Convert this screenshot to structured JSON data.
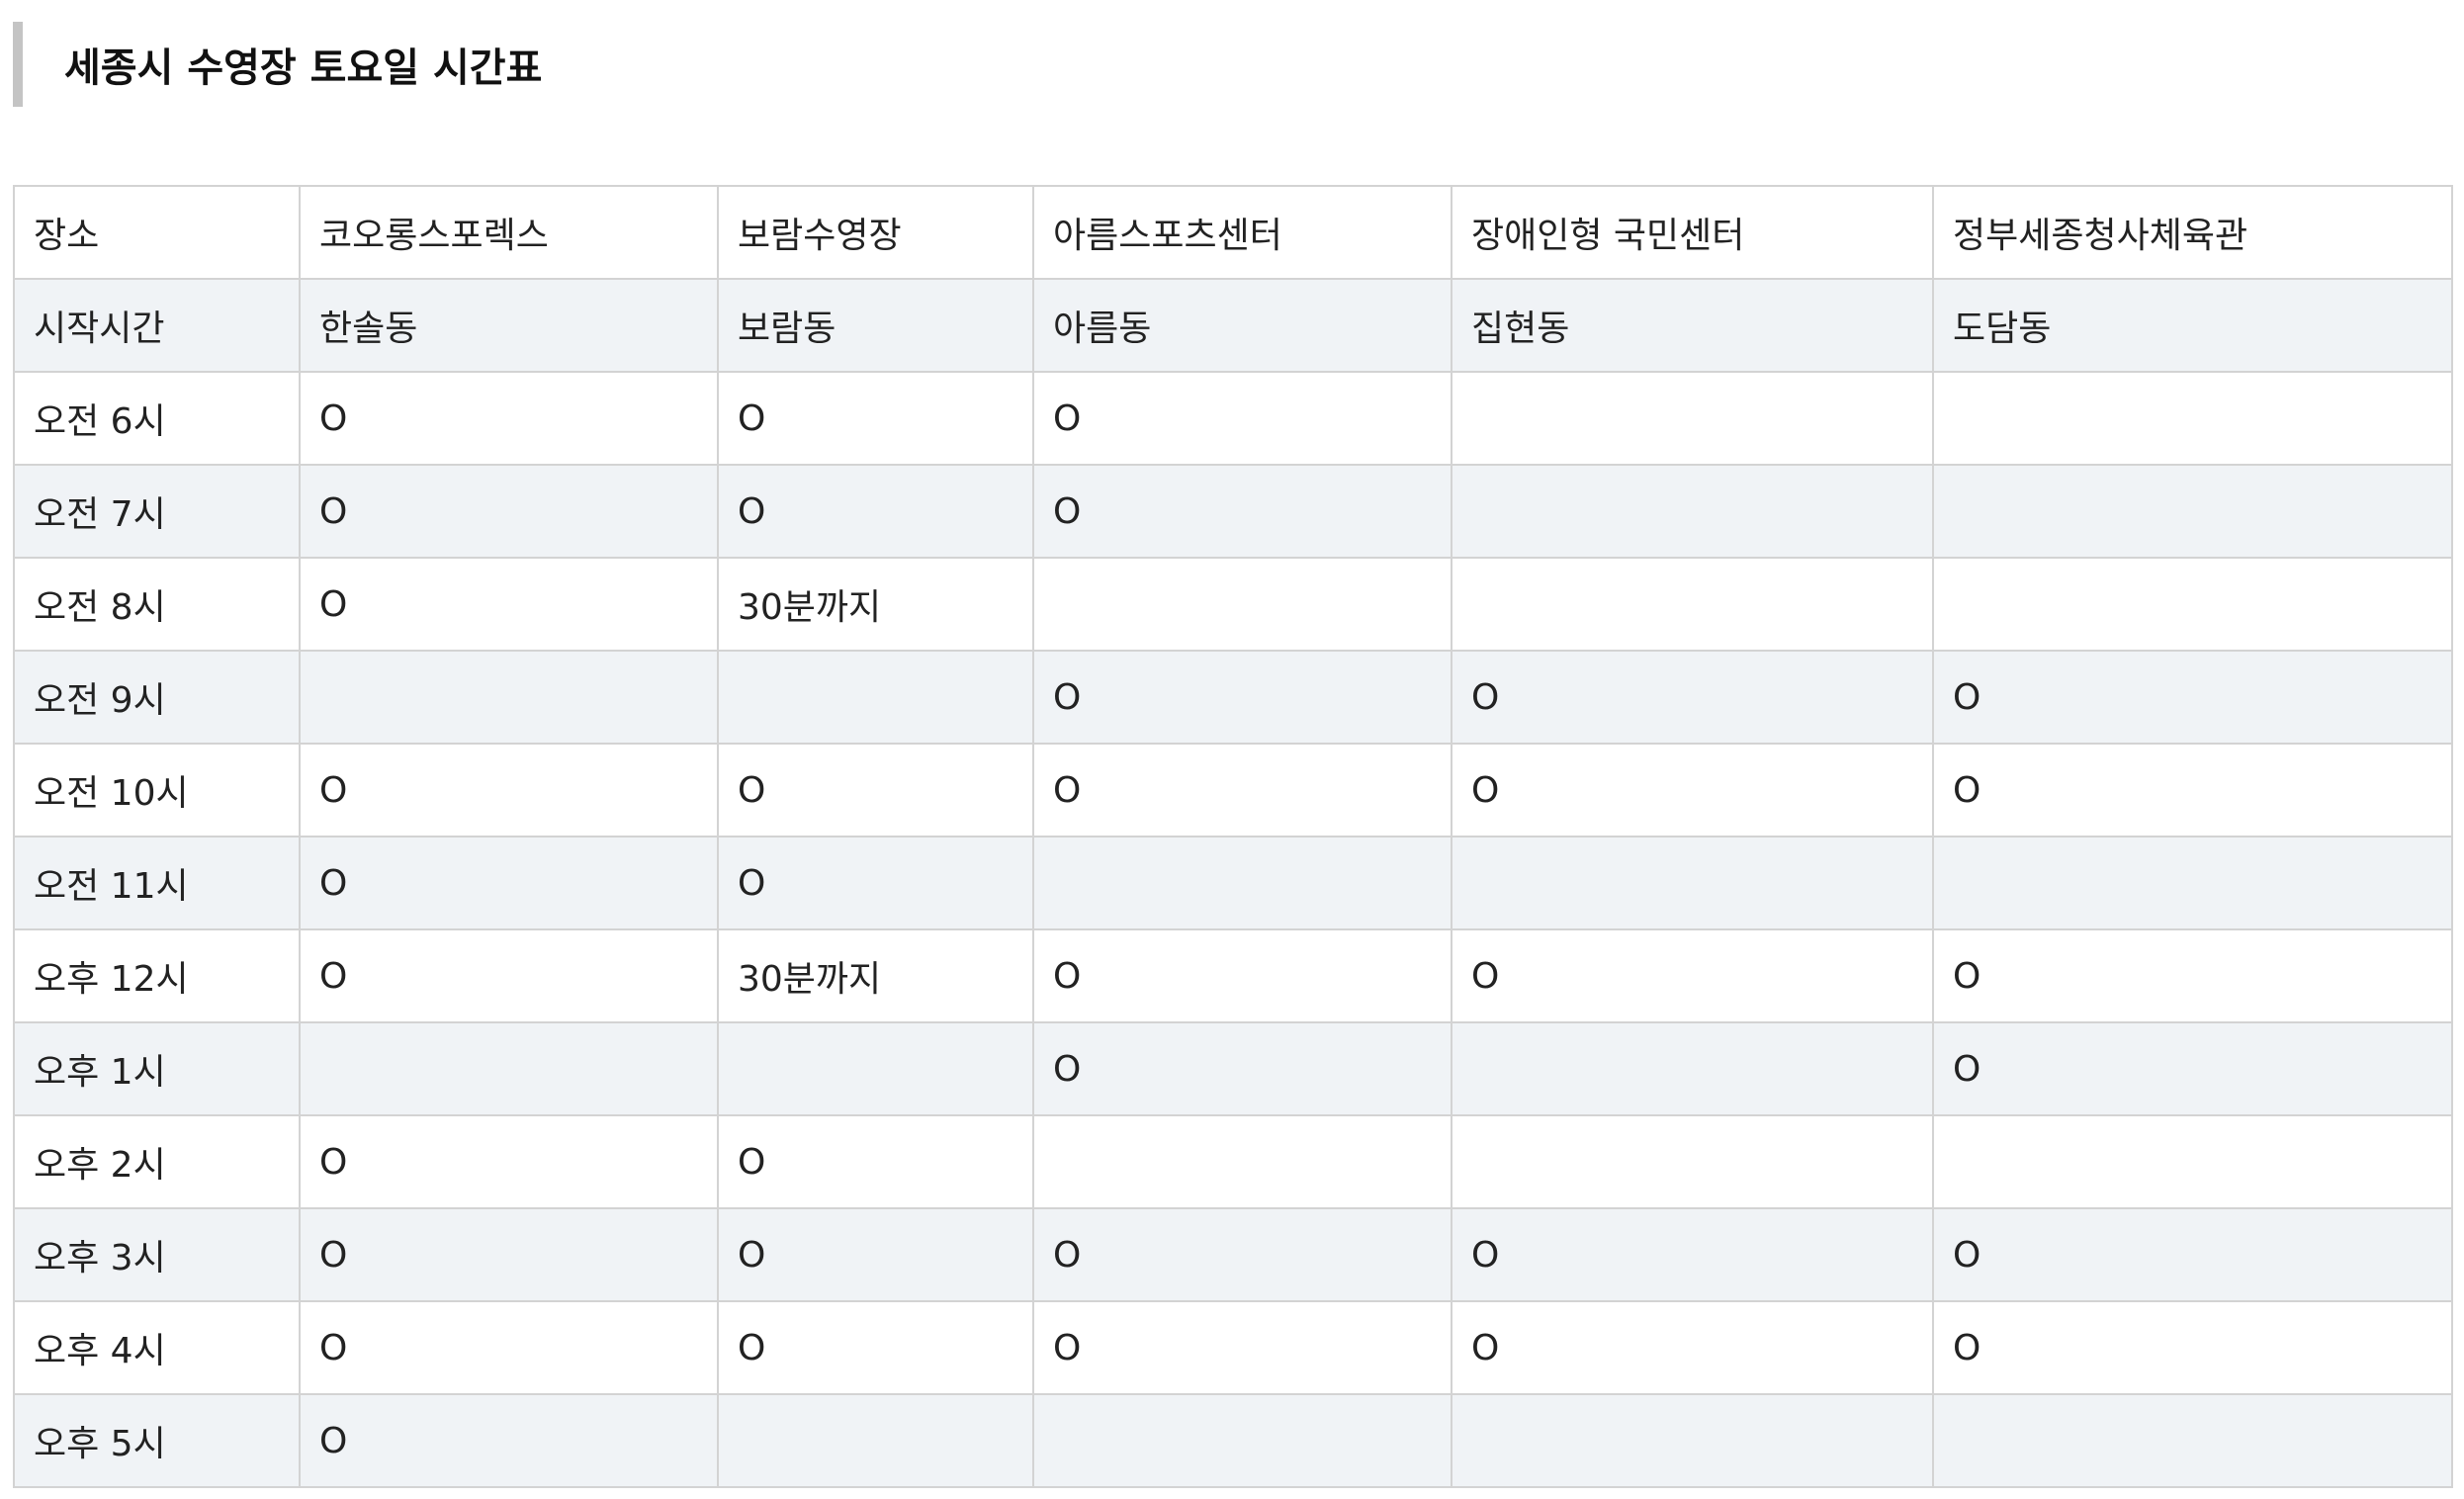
{
  "page": {
    "title": "세종시 수영장 토요일 시간표"
  },
  "table": {
    "header": [
      "장소",
      "코오롱스포렉스",
      "보람수영장",
      "아름스포츠센터",
      "장애인형 국민센터",
      "정부세종청사체육관"
    ],
    "rows": [
      [
        "시작시간",
        "한솔동",
        "보람동",
        "아름동",
        "집현동",
        "도담동"
      ],
      [
        "오전 6시",
        "O",
        "O",
        "O",
        "",
        ""
      ],
      [
        "오전 7시",
        "O",
        "O",
        "O",
        "",
        ""
      ],
      [
        "오전 8시",
        "O",
        "30분까지",
        "",
        "",
        ""
      ],
      [
        "오전 9시",
        "",
        "",
        "O",
        "O",
        "O"
      ],
      [
        "오전 10시",
        "O",
        "O",
        "O",
        "O",
        "O"
      ],
      [
        "오전 11시",
        "O",
        "O",
        "",
        "",
        ""
      ],
      [
        "오후 12시",
        "O",
        "30분까지",
        "O",
        "O",
        "O"
      ],
      [
        "오후 1시",
        "",
        "",
        "O",
        "",
        "O"
      ],
      [
        "오후 2시",
        "O",
        "O",
        "",
        "",
        ""
      ],
      [
        "오후 3시",
        "O",
        "O",
        "O",
        "O",
        "O"
      ],
      [
        "오후 4시",
        "O",
        "O",
        "O",
        "O",
        "O"
      ],
      [
        "오후 5시",
        "O",
        "",
        "",
        "",
        ""
      ]
    ]
  }
}
